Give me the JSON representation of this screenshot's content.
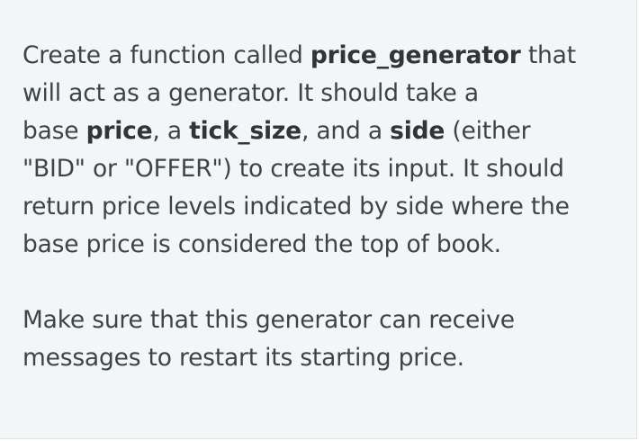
{
  "instructions": {
    "paragraph1": {
      "t1": "Create a function called ",
      "k1": "price_generator",
      "t2": " that",
      "t3": "will act as a generator. It should take a",
      "t4": "base ",
      "k2": "price",
      "t5": ", a ",
      "k3": "tick_size",
      "t6": ", and a ",
      "k4": "side",
      "t7": " (either",
      "t8": "\"BID\" or \"OFFER\") to create its input. It should",
      "t9": "return price levels indicated by side where the",
      "t10": "base price is considered the top of book."
    },
    "paragraph2": {
      "l1": "Make sure that this generator can receive",
      "l2": "messages to restart its starting price."
    }
  }
}
